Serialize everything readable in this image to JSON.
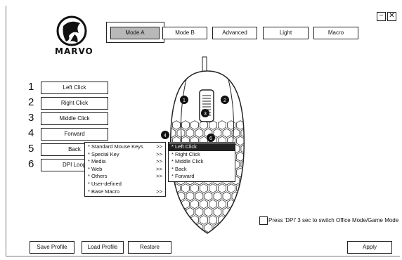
{
  "window": {
    "minimize_label": "−",
    "close_label": "✕"
  },
  "brand": {
    "logo_text": "MARVO"
  },
  "modes": [
    {
      "label": "Mode A",
      "active": true
    },
    {
      "label": "Mode B",
      "active": false
    },
    {
      "label": "Advanced",
      "active": false
    },
    {
      "label": "Light",
      "active": false
    },
    {
      "label": "Macro",
      "active": false
    }
  ],
  "keys": [
    {
      "number": "1",
      "label": "Left Click"
    },
    {
      "number": "2",
      "label": "Right Click"
    },
    {
      "number": "3",
      "label": "Middle Click"
    },
    {
      "number": "4",
      "label": "Forward"
    },
    {
      "number": "5",
      "label": "Back"
    },
    {
      "number": "6",
      "label": "DPI Loop"
    }
  ],
  "mouse_badges": [
    "1",
    "2",
    "3",
    "4",
    "6"
  ],
  "function_menu": [
    {
      "label": "* Standard Mouse Keys",
      "arrow": ">>"
    },
    {
      "label": "* Special Key",
      "arrow": ">>"
    },
    {
      "label": "* Media",
      "arrow": ">>"
    },
    {
      "label": "* Web",
      "arrow": ">>"
    },
    {
      "label": "* Others",
      "arrow": ">>"
    },
    {
      "label": "* User-defined",
      "arrow": ""
    },
    {
      "label": "* Base Macro",
      "arrow": ">>"
    }
  ],
  "submenu": [
    {
      "label": "* Left Click",
      "selected": true
    },
    {
      "label": "* Right Click",
      "selected": false
    },
    {
      "label": "* Middle Click",
      "selected": false
    },
    {
      "label": "* Back",
      "selected": false
    },
    {
      "label": "* Forward",
      "selected": false
    }
  ],
  "office_mode": {
    "label": "Press 'DPI' 3 sec to switch Office Mode/Game Mode",
    "checked": false
  },
  "footer": {
    "save_profile": "Save Profile",
    "load_profile": "Load Profile",
    "restore": "Restore",
    "apply": "Apply"
  }
}
